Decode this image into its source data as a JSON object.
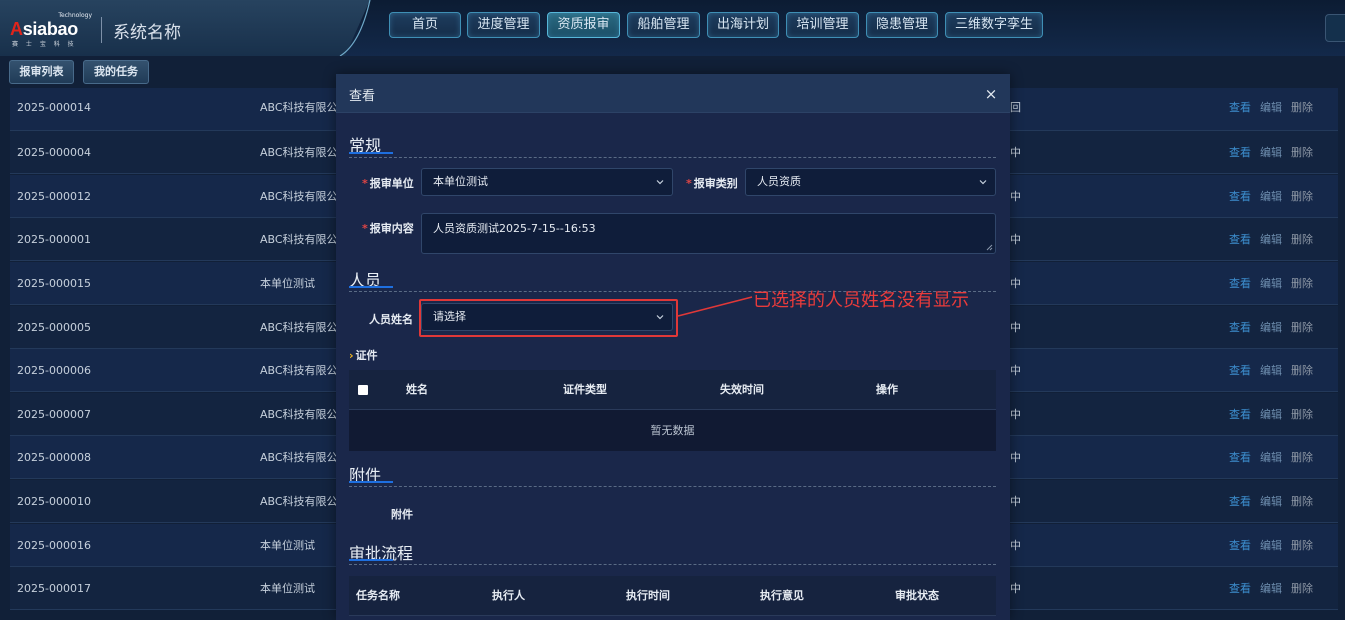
{
  "header": {
    "logo_tech": "Technology",
    "logo_word_a": "A",
    "logo_word_rest": "siabao",
    "logo_cn": "赛 士 宝 科 技",
    "system_name": "系统名称",
    "nav": [
      "首页",
      "进度管理",
      "资质报审",
      "船舶管理",
      "出海计划",
      "培训管理",
      "隐患管理",
      "三维数字孪生"
    ],
    "active_nav": "资质报审",
    "accent_color": "#57b7d9"
  },
  "subtabs": [
    "报审列表",
    "我的任务"
  ],
  "table": {
    "rows": [
      {
        "id": "2025-000014",
        "unit": "ABC科技有限公司",
        "status": "回"
      },
      {
        "id": "2025-000004",
        "unit": "ABC科技有限公司",
        "status": "中"
      },
      {
        "id": "2025-000012",
        "unit": "ABC科技有限公司",
        "status": "中"
      },
      {
        "id": "2025-000001",
        "unit": "ABC科技有限公司",
        "status": "中"
      },
      {
        "id": "2025-000015",
        "unit": "本单位测试",
        "status": "中"
      },
      {
        "id": "2025-000005",
        "unit": "ABC科技有限公司",
        "status": "中"
      },
      {
        "id": "2025-000006",
        "unit": "ABC科技有限公司",
        "status": "中"
      },
      {
        "id": "2025-000007",
        "unit": "ABC科技有限公司",
        "status": "中"
      },
      {
        "id": "2025-000008",
        "unit": "ABC科技有限公司",
        "status": "中"
      },
      {
        "id": "2025-000010",
        "unit": "ABC科技有限公司",
        "status": "中"
      },
      {
        "id": "2025-000016",
        "unit": "本单位测试",
        "status": "中"
      },
      {
        "id": "2025-000017",
        "unit": "本单位测试",
        "status": "中"
      }
    ],
    "actions": {
      "view": "查看",
      "edit": "编辑",
      "delete": "删除"
    }
  },
  "modal": {
    "title": "查看",
    "close": "×",
    "section_general": "常规",
    "label_unit": "报审单位",
    "value_unit": "本单位测试",
    "label_category": "报审类别",
    "value_category": "人员资质",
    "label_content": "报审内容",
    "value_content": "人员资质测试2025-7-15--16:53",
    "required_mark": "*",
    "section_person": "人员",
    "label_person_name": "人员姓名",
    "person_placeholder": "请选择",
    "sub_certificate": "证件",
    "cert_columns": [
      "姓名",
      "证件类型",
      "失效时间",
      "操作"
    ],
    "empty_text": "暂无数据",
    "section_attachment": "附件",
    "label_attachment": "附件",
    "section_approval": "审批流程",
    "approval_columns": [
      "任务名称",
      "执行人",
      "执行时间",
      "执行意见",
      "审批状态"
    ]
  },
  "annotation": {
    "text": "已选择的人员姓名没有显示",
    "color": "#ea3b3b"
  }
}
